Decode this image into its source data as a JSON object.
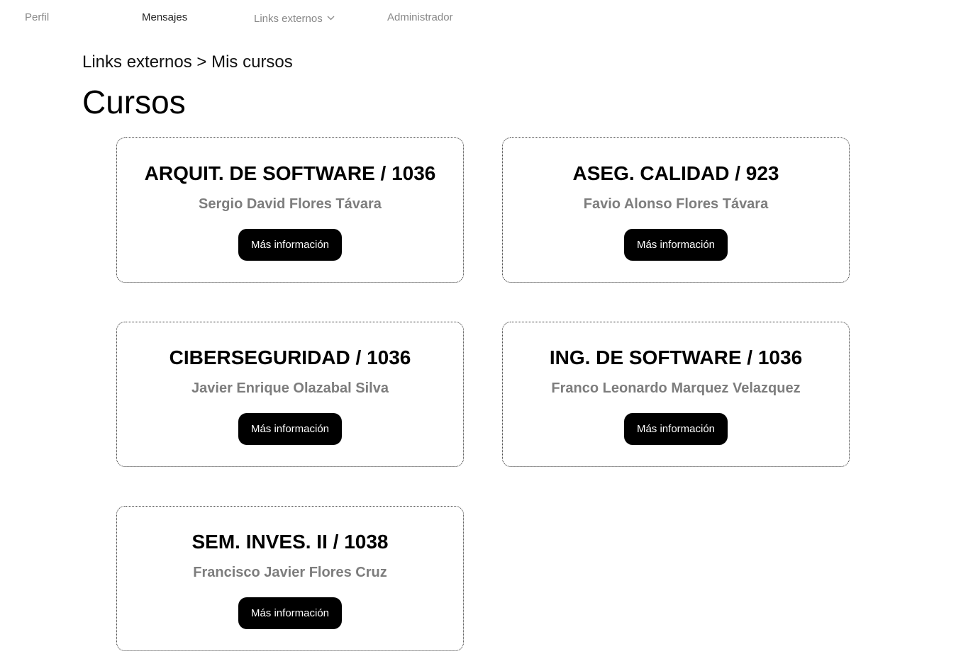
{
  "nav": {
    "items": [
      {
        "label": "Perfil"
      },
      {
        "label": "Mensajes"
      },
      {
        "label": "Links externos"
      },
      {
        "label": "Administrador"
      }
    ],
    "dropdown_icon": "chevron-down-icon"
  },
  "breadcrumb": "Links externos > Mis cursos",
  "page_title": "Cursos",
  "courses": [
    {
      "title": "ARQUIT. DE SOFTWARE / 1036",
      "teacher": "Sergio David Flores Távara",
      "button": "Más información"
    },
    {
      "title": "ASEG. CALIDAD / 923",
      "teacher": "Favio Alonso Flores Távara",
      "button": "Más información"
    },
    {
      "title": "CIBERSEGURIDAD / 1036",
      "teacher": "Javier Enrique Olazabal Silva",
      "button": "Más información"
    },
    {
      "title": "ING. DE SOFTWARE / 1036",
      "teacher": "Franco Leonardo Marquez Velazquez",
      "button": "Más información"
    },
    {
      "title": "SEM. INVES. II / 1038",
      "teacher": "Francisco Javier Flores Cruz",
      "button": "Más información"
    }
  ],
  "colors": {
    "button_bg": "#000000",
    "button_text": "#ffffff",
    "teacher_text": "#7d7d7d",
    "nav_text": "#888888"
  }
}
